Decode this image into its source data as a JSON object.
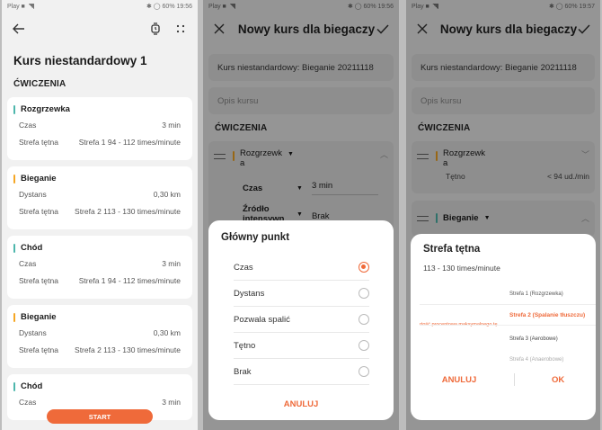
{
  "screen1": {
    "status": {
      "left": "Play ■",
      "right": "✱ ◯ 60% 19:56"
    },
    "title": "Kurs niestandardowy 1",
    "section": "ĆWICZENIA",
    "cards": [
      {
        "name": "Rozgrzewka",
        "color": "#4db6ac",
        "rows": [
          [
            "Czas",
            "3 min"
          ],
          [
            "Strefa tętna",
            "Strefa 1 94 - 112 times/minute"
          ]
        ]
      },
      {
        "name": "Bieganie",
        "color": "#f5a623",
        "rows": [
          [
            "Dystans",
            "0,30 km"
          ],
          [
            "Strefa tętna",
            "Strefa 2 113 - 130 times/minute"
          ]
        ]
      },
      {
        "name": "Chód",
        "color": "#4db6ac",
        "rows": [
          [
            "Czas",
            "3 min"
          ],
          [
            "Strefa tętna",
            "Strefa 1 94 - 112 times/minute"
          ]
        ]
      },
      {
        "name": "Bieganie",
        "color": "#f5a623",
        "rows": [
          [
            "Dystans",
            "0,30 km"
          ],
          [
            "Strefa tętna",
            "Strefa 2 113 - 130 times/minute"
          ]
        ]
      },
      {
        "name": "Chód",
        "color": "#4db6ac",
        "rows": [
          [
            "Czas",
            "3 min"
          ]
        ]
      }
    ],
    "start_label": "START"
  },
  "screen2": {
    "status": {
      "left": "Play ■",
      "right": "✱ ◯ 60% 19:56"
    },
    "title": "Nowy kurs dla biegaczy",
    "name_value": "Kurs niestandardowy: Bieganie 20211118",
    "desc_placeholder": "Opis kursu",
    "section": "ĆWICZENIA",
    "exercise": {
      "name_line1": "Rozgrzewk",
      "name_line2": "a",
      "color": "#f5a623"
    },
    "param1": {
      "label": "Czas",
      "value": "3 min"
    },
    "param2": {
      "label_line1": "Źródło",
      "label_line2": "intensywn",
      "value": "Brak"
    },
    "sheet": {
      "title": "Główny punkt",
      "options": [
        {
          "label": "Czas",
          "selected": true
        },
        {
          "label": "Dystans",
          "selected": false
        },
        {
          "label": "Pozwala spalić",
          "selected": false
        },
        {
          "label": "Tętno",
          "selected": false
        },
        {
          "label": "Brak",
          "selected": false
        }
      ],
      "cancel": "ANULUJ"
    }
  },
  "screen3": {
    "status": {
      "left": "Play ■",
      "right": "✱ ◯ 60% 19:57"
    },
    "title": "Nowy kurs dla biegaczy",
    "name_value": "Kurs niestandardowy: Bieganie 20211118",
    "desc_placeholder": "Opis kursu",
    "section": "ĆWICZENIA",
    "exercise1": {
      "name_line1": "Rozgrzewk",
      "name_line2": "a",
      "color": "#f5a623",
      "param_label": "Tętno",
      "param_value": "< 94 ud./min"
    },
    "exercise2": {
      "name": "Bieganie",
      "color": "#4db6ac"
    },
    "sheet": {
      "title": "Strefa tętna",
      "subtitle": "113 - 130 times/minute",
      "picker_left": "rtość procentowa maksymalnego tę",
      "picker_items": [
        "Strefa 1 (Rozgrzewka)",
        "Strefa 2 (Spalanie tłuszczu)",
        "Strefa 3 (Aerobowe)",
        "Strefa 4 (Anaerobowe)"
      ],
      "cancel": "ANULUJ",
      "ok": "OK"
    }
  },
  "accent": "#ef6a3a"
}
